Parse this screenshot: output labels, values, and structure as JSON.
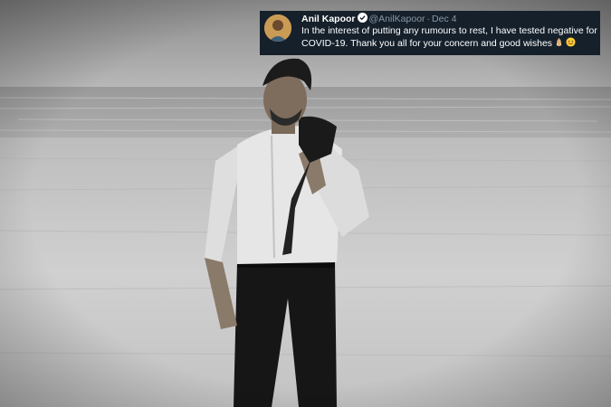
{
  "tweet": {
    "author_name": "Anil Kapoor",
    "handle": "@AnilKapoor",
    "separator": "·",
    "date": "Dec 4",
    "text": "In the interest of putting any rumours to rest, I have tested negative for COVID-19. Thank you all for your concern and good wishes",
    "emojis": [
      "folded-hands-icon",
      "smiling-face-icon"
    ],
    "theme": {
      "background": "#15202b",
      "text": "#ffffff",
      "muted": "#8899a6",
      "verified": "#1da1f2"
    }
  },
  "photo": {
    "style": "black-and-white",
    "subject": "man in white shirt walking on beach with jacket over shoulder"
  }
}
